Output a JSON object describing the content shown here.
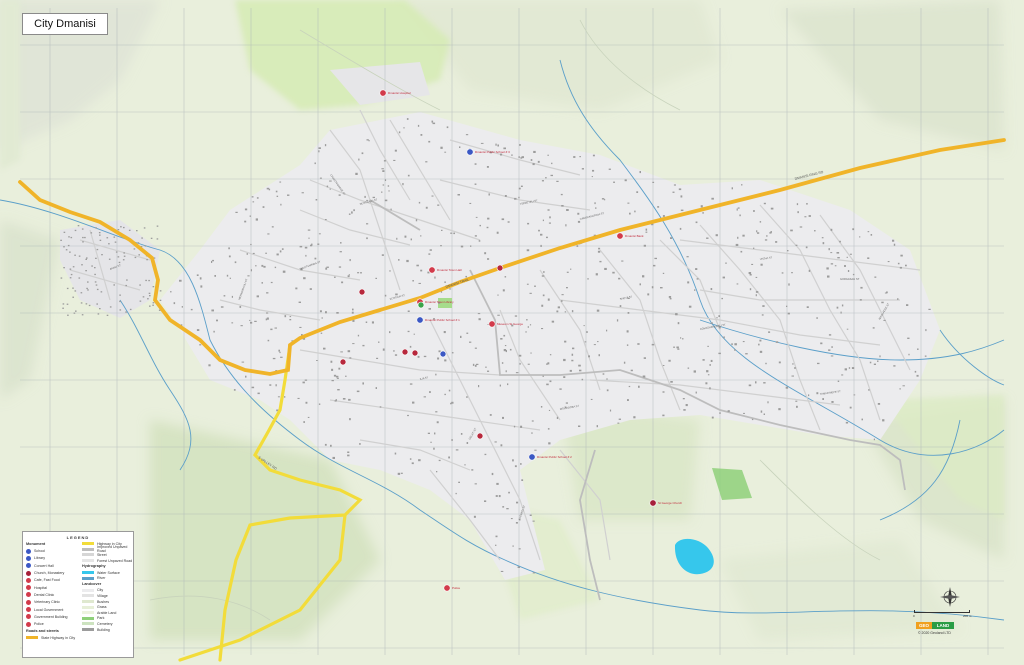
{
  "title": "City Dmanisi",
  "colors": {
    "terrain": "#e9efdc",
    "forest": "#d8ecc2",
    "city": "#ececee",
    "water": "#36c7ec",
    "stream": "#5b9fc9",
    "highway": "#f0b429",
    "highway_yellow": "#f2dc3a",
    "road": "#c9c9c9",
    "building": "#9c9c9c",
    "park": "#8fd07a",
    "grid": "#aab3b8"
  },
  "roads": {
    "highway_label_east": "DMANISI RING RD",
    "highway_label_center": "DMANISI TRAIL",
    "highway_label_south": "S VALLEY RD"
  },
  "streets": [
    "CHAVCHAVADZE ST",
    "RUSTAVELI ST",
    "NINOTSMINDA ST",
    "MERABISHVILI ST",
    "KOSTAVA ST",
    "TSERETELI ST",
    "GAMSAKHURDIA ST",
    "SHOTA ST",
    "AGMASHENEBELI ST",
    "VAZHA ST",
    "GORGASALI ST",
    "TAMAR MEPE ST",
    "MSHVIDOBA ST",
    "GELATI ST",
    "KAZBEGI ST",
    "ILIA ST",
    "AKAKI ST",
    "NIKOLADZE ST"
  ],
  "pois": [
    {
      "name": "Dmanisi Hospital",
      "color": "#d23b4b",
      "icon": "hospital"
    },
    {
      "name": "Dmanisi Public School # 3",
      "color": "#3b58c4",
      "icon": "school"
    },
    {
      "name": "Dmanisi Town Hall",
      "color": "#d23b4b",
      "icon": "government"
    },
    {
      "name": "Dmanisi Bank",
      "color": "#d23b4b",
      "icon": "bank"
    },
    {
      "name": "Museum St George",
      "color": "#d23b4b",
      "icon": "museum"
    },
    {
      "name": "Dmanisi Public School # 1",
      "color": "#3b58c4",
      "icon": "school"
    },
    {
      "name": "Dmanisi Town Library",
      "color": "#d23b4b",
      "icon": "library"
    },
    {
      "name": "Dmanisi Public School # 2",
      "color": "#3b58c4",
      "icon": "school"
    },
    {
      "name": "St George Church",
      "color": "#a6203a",
      "icon": "church"
    },
    {
      "name": "Police",
      "color": "#d23b4b",
      "icon": "police"
    }
  ],
  "legend": {
    "title": "LEGEND",
    "monument_head": "Monument",
    "monuments": [
      {
        "label": "School",
        "color": "#3b58c4"
      },
      {
        "label": "Library",
        "color": "#3b58c4"
      },
      {
        "label": "Concert Hall",
        "color": "#3b58c4"
      },
      {
        "label": "Church, Monastery",
        "color": "#a6203a"
      },
      {
        "label": "Cafe, Fast Food",
        "color": "#d23b4b"
      },
      {
        "label": "Hospital",
        "color": "#d23b4b"
      },
      {
        "label": "Dental Clinic",
        "color": "#d23b4b"
      },
      {
        "label": "Veterinary Clinic",
        "color": "#d23b4b"
      },
      {
        "label": "Local Government",
        "color": "#d23b4b"
      },
      {
        "label": "Government Building",
        "color": "#d23b4b"
      },
      {
        "label": "Police",
        "color": "#d23b4b"
      }
    ],
    "roads_head": "Roads and streets",
    "roads_first": {
      "label": "State Highway in City",
      "color": "#f0b429"
    },
    "roads": [
      {
        "label": "Highway in City",
        "color": "#f2dc3a"
      },
      {
        "label": "Improved Unpaved Road",
        "color": "#bdbdbd"
      },
      {
        "label": "Street",
        "color": "#d6d6d6"
      },
      {
        "label": "Forest Unpaved Road",
        "color": "#e6e6e6"
      }
    ],
    "hydro_head": "Hydrography",
    "hydro": [
      {
        "label": "Water Surface",
        "color": "#36c7ec"
      },
      {
        "label": "River",
        "color": "#5b9fc9"
      }
    ],
    "land_head": "Landcover",
    "land": [
      {
        "label": "City",
        "color": "#ececee"
      },
      {
        "label": "Village",
        "color": "#e3e3e3"
      },
      {
        "label": "Bushes",
        "color": "#dfe8cf"
      },
      {
        "label": "Grass",
        "color": "#e7efd8"
      },
      {
        "label": "Arable Land",
        "color": "#eef3e1"
      },
      {
        "label": "Park",
        "color": "#8fd07a"
      },
      {
        "label": "Cemetery",
        "color": "#cde3c0"
      },
      {
        "label": "Building",
        "color": "#9c9c9c"
      }
    ]
  },
  "scale": {
    "left": "0",
    "right": "200 m"
  },
  "brand": {
    "part1": "GEO",
    "part2": "LAND",
    "copyright": "© 2020 Geoland LTD"
  }
}
